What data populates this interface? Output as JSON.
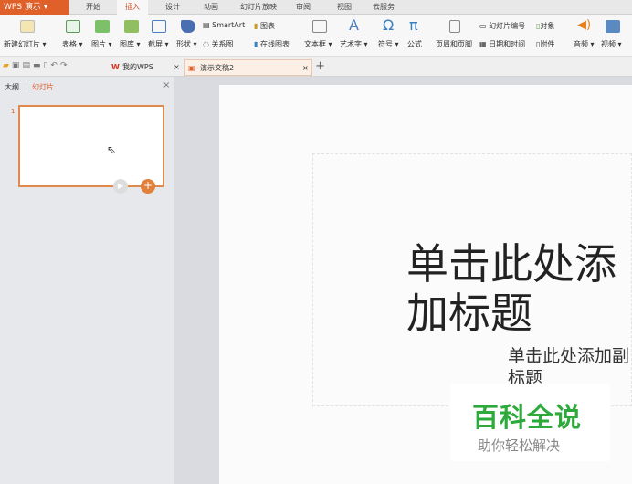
{
  "app": {
    "title": "WPS 演示"
  },
  "menu_tabs": [
    "开始",
    "插入",
    "设计",
    "动画",
    "幻灯片放映",
    "审阅",
    "视图",
    "云服务"
  ],
  "active_tab": "插入",
  "ribbon": {
    "new_slide": "新建幻灯片 ▾",
    "table": "表格 ▾",
    "picture": "图片 ▾",
    "gallery": "图库 ▾",
    "screenshot": "截屏 ▾",
    "shape": "形状 ▾",
    "smartart": "SmartArt",
    "chart": "图表",
    "relation": "关系图",
    "online_chart": "在线图表",
    "textbox": "文本框 ▾",
    "wordart": "艺术字 ▾",
    "symbol": "符号 ▾",
    "formula": "公式",
    "header_footer": "页眉和页脚",
    "slide_number": "幻灯片编号",
    "object": "对象",
    "datetime": "日期和时间",
    "attachment": "附件",
    "audio": "音频 ▾",
    "video": "视频 ▾"
  },
  "doc_tabs": [
    {
      "label": "我的WPS",
      "close": "×"
    },
    {
      "label": "演示文稿2",
      "close": "×"
    }
  ],
  "new_tab": "+",
  "left_panel": {
    "tabs": [
      "大纲",
      "幻灯片"
    ],
    "active": "幻灯片",
    "close": "×",
    "slide_index": "1"
  },
  "slide": {
    "title": "单击此处添加标题",
    "subtitle": "单击此处添加副标题"
  },
  "watermark": {
    "brand": "百科全说",
    "slogan": "助你轻松解决"
  },
  "colors": {
    "accent": "#e0602a",
    "brand_green": "#2eaa3c"
  }
}
